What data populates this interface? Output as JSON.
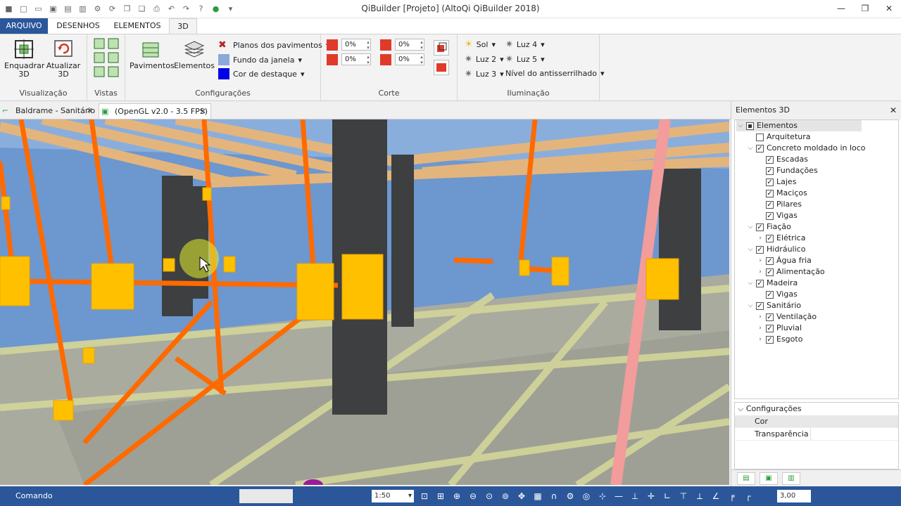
{
  "app_title": "QiBuilder [Projeto] (AltoQi QiBuilder 2018)",
  "qat_icons": [
    "app-icon",
    "new-icon",
    "open-icon",
    "close-file-icon",
    "save-icon",
    "print-icon",
    "settings-icon",
    "undo-icon",
    "redo-icon",
    "help-icon",
    "update-icon",
    "dropdown-icon"
  ],
  "ribbon_tabs": [
    {
      "label": "ARQUIVO"
    },
    {
      "label": "DESENHOS"
    },
    {
      "label": "ELEMENTOS"
    },
    {
      "label": "3D"
    }
  ],
  "groups": {
    "visualizacao": {
      "label": "Visualização",
      "enquadrar": "Enquadrar 3D",
      "atualizar": "Atualizar 3D"
    },
    "vistas": {
      "label": "Vistas"
    },
    "configuracoes": {
      "label": "Configurações",
      "pavimentos": "Pavimentos",
      "elementos": "Elementos",
      "planos": "Planos dos pavimentos",
      "fundo": "Fundo da janela",
      "cor": "Cor de destaque"
    },
    "corte": {
      "label": "Corte",
      "v1": "0%",
      "v2": "0%",
      "v3": "0%",
      "v4": "0%"
    },
    "iluminacao": {
      "label": "Iluminação",
      "sol": "Sol",
      "luz2": "Luz 2",
      "luz3": "Luz 3",
      "luz4": "Luz 4",
      "luz5": "Luz 5",
      "antialias": "Nível do antisserrilhado"
    }
  },
  "doc_tabs": [
    {
      "label": "Baldrame - Sanitário"
    },
    {
      "label": "(OpenGL v2.0 - 3.5 FPS)"
    }
  ],
  "panel": {
    "title": "Elementos 3D",
    "tree": [
      {
        "label": "Elementos"
      },
      {
        "label": "Arquitetura"
      },
      {
        "label": "Concreto moldado in loco"
      },
      {
        "label": "Escadas"
      },
      {
        "label": "Fundações"
      },
      {
        "label": "Lajes"
      },
      {
        "label": "Maciços"
      },
      {
        "label": "Pilares"
      },
      {
        "label": "Vigas"
      },
      {
        "label": "Fiação"
      },
      {
        "label": "Elétrica"
      },
      {
        "label": "Hidráulico"
      },
      {
        "label": "Água fria"
      },
      {
        "label": "Alimentação"
      },
      {
        "label": "Madeira"
      },
      {
        "label": "Vigas"
      },
      {
        "label": "Sanitário"
      },
      {
        "label": "Ventilação"
      },
      {
        "label": "Pluvial"
      },
      {
        "label": "Esgoto"
      }
    ],
    "config": {
      "title": "Configurações",
      "row1": "Cor",
      "row2": "Transparência"
    }
  },
  "status": {
    "command": "Comando",
    "scale": "1:50",
    "zoom": "3,00"
  },
  "colors": {
    "accent": "#2b579a",
    "pipe": "#ff6a00",
    "box": "#ffc000",
    "sky": "#6d97cf"
  }
}
